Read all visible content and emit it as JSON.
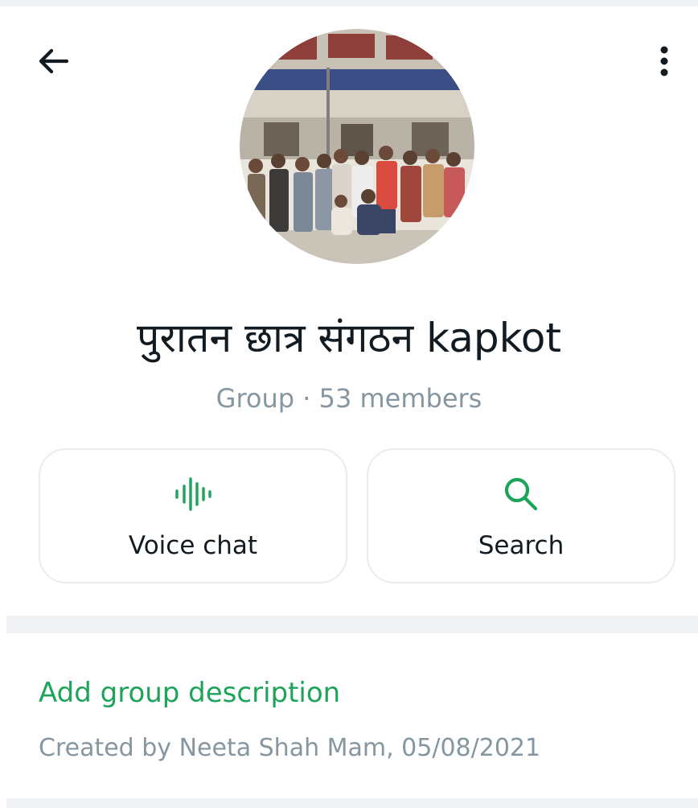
{
  "header": {
    "back_icon": "arrow-left-icon",
    "menu_icon": "vertical-dots-icon"
  },
  "group": {
    "name": "पुरातन छात्र संगठन kapkot",
    "meta": "Group · 53 members"
  },
  "actions": [
    {
      "label": "Voice chat",
      "icon": "voice-wave-icon"
    },
    {
      "label": "Search",
      "icon": "search-icon"
    }
  ],
  "description": {
    "add_label": "Add group description",
    "created_text": "Created by Neeta Shah Mam, 05/08/2021"
  },
  "colors": {
    "accent": "#1da35a",
    "muted": "#8696a0",
    "text": "#111b21",
    "divider": "#f0f2f5"
  }
}
